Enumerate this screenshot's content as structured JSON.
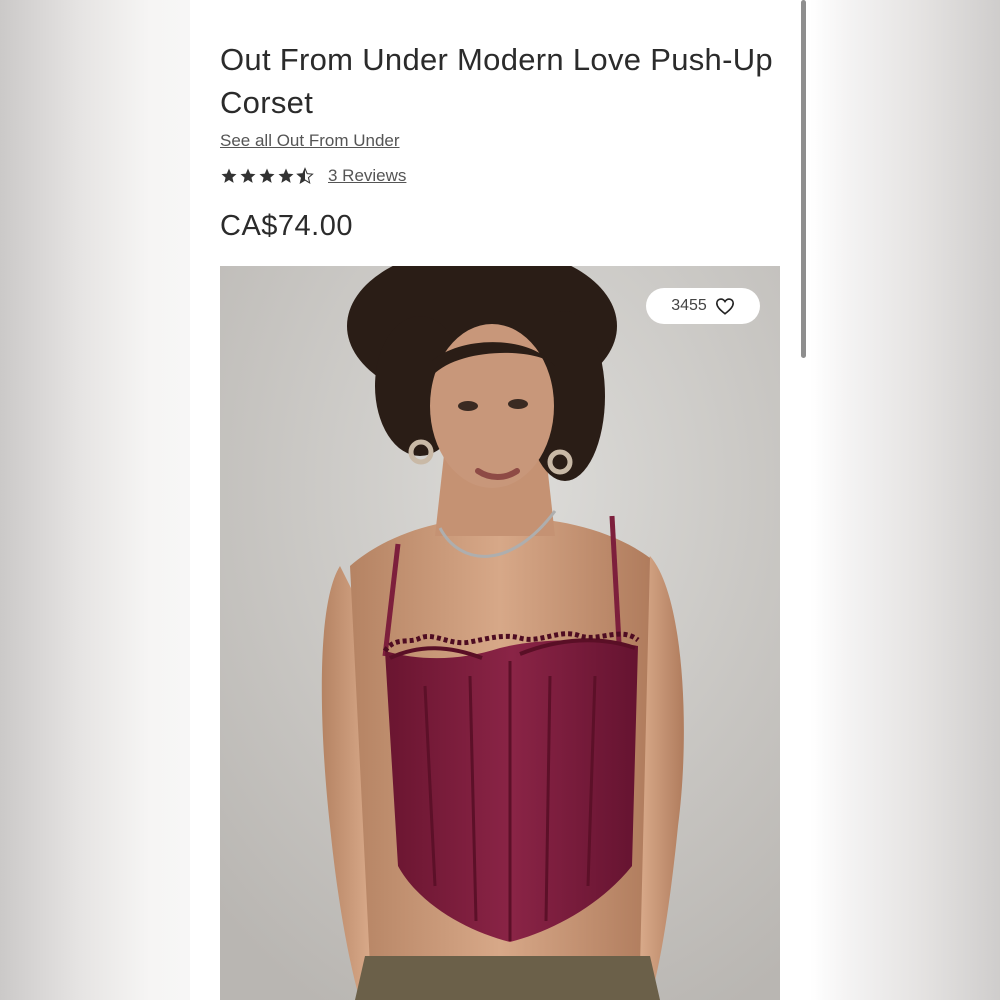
{
  "product": {
    "title": "Out From Under Modern Love Push-Up Corset",
    "brand_link": "See all Out From Under",
    "rating": 4.5,
    "reviews_link": "3 Reviews",
    "price": "CA$74.00"
  },
  "image": {
    "favorite_count": "3455",
    "favorite_icon": "heart-outline-icon"
  },
  "colors": {
    "text": "#2b2b2b",
    "corset": "#7d1f3c"
  }
}
